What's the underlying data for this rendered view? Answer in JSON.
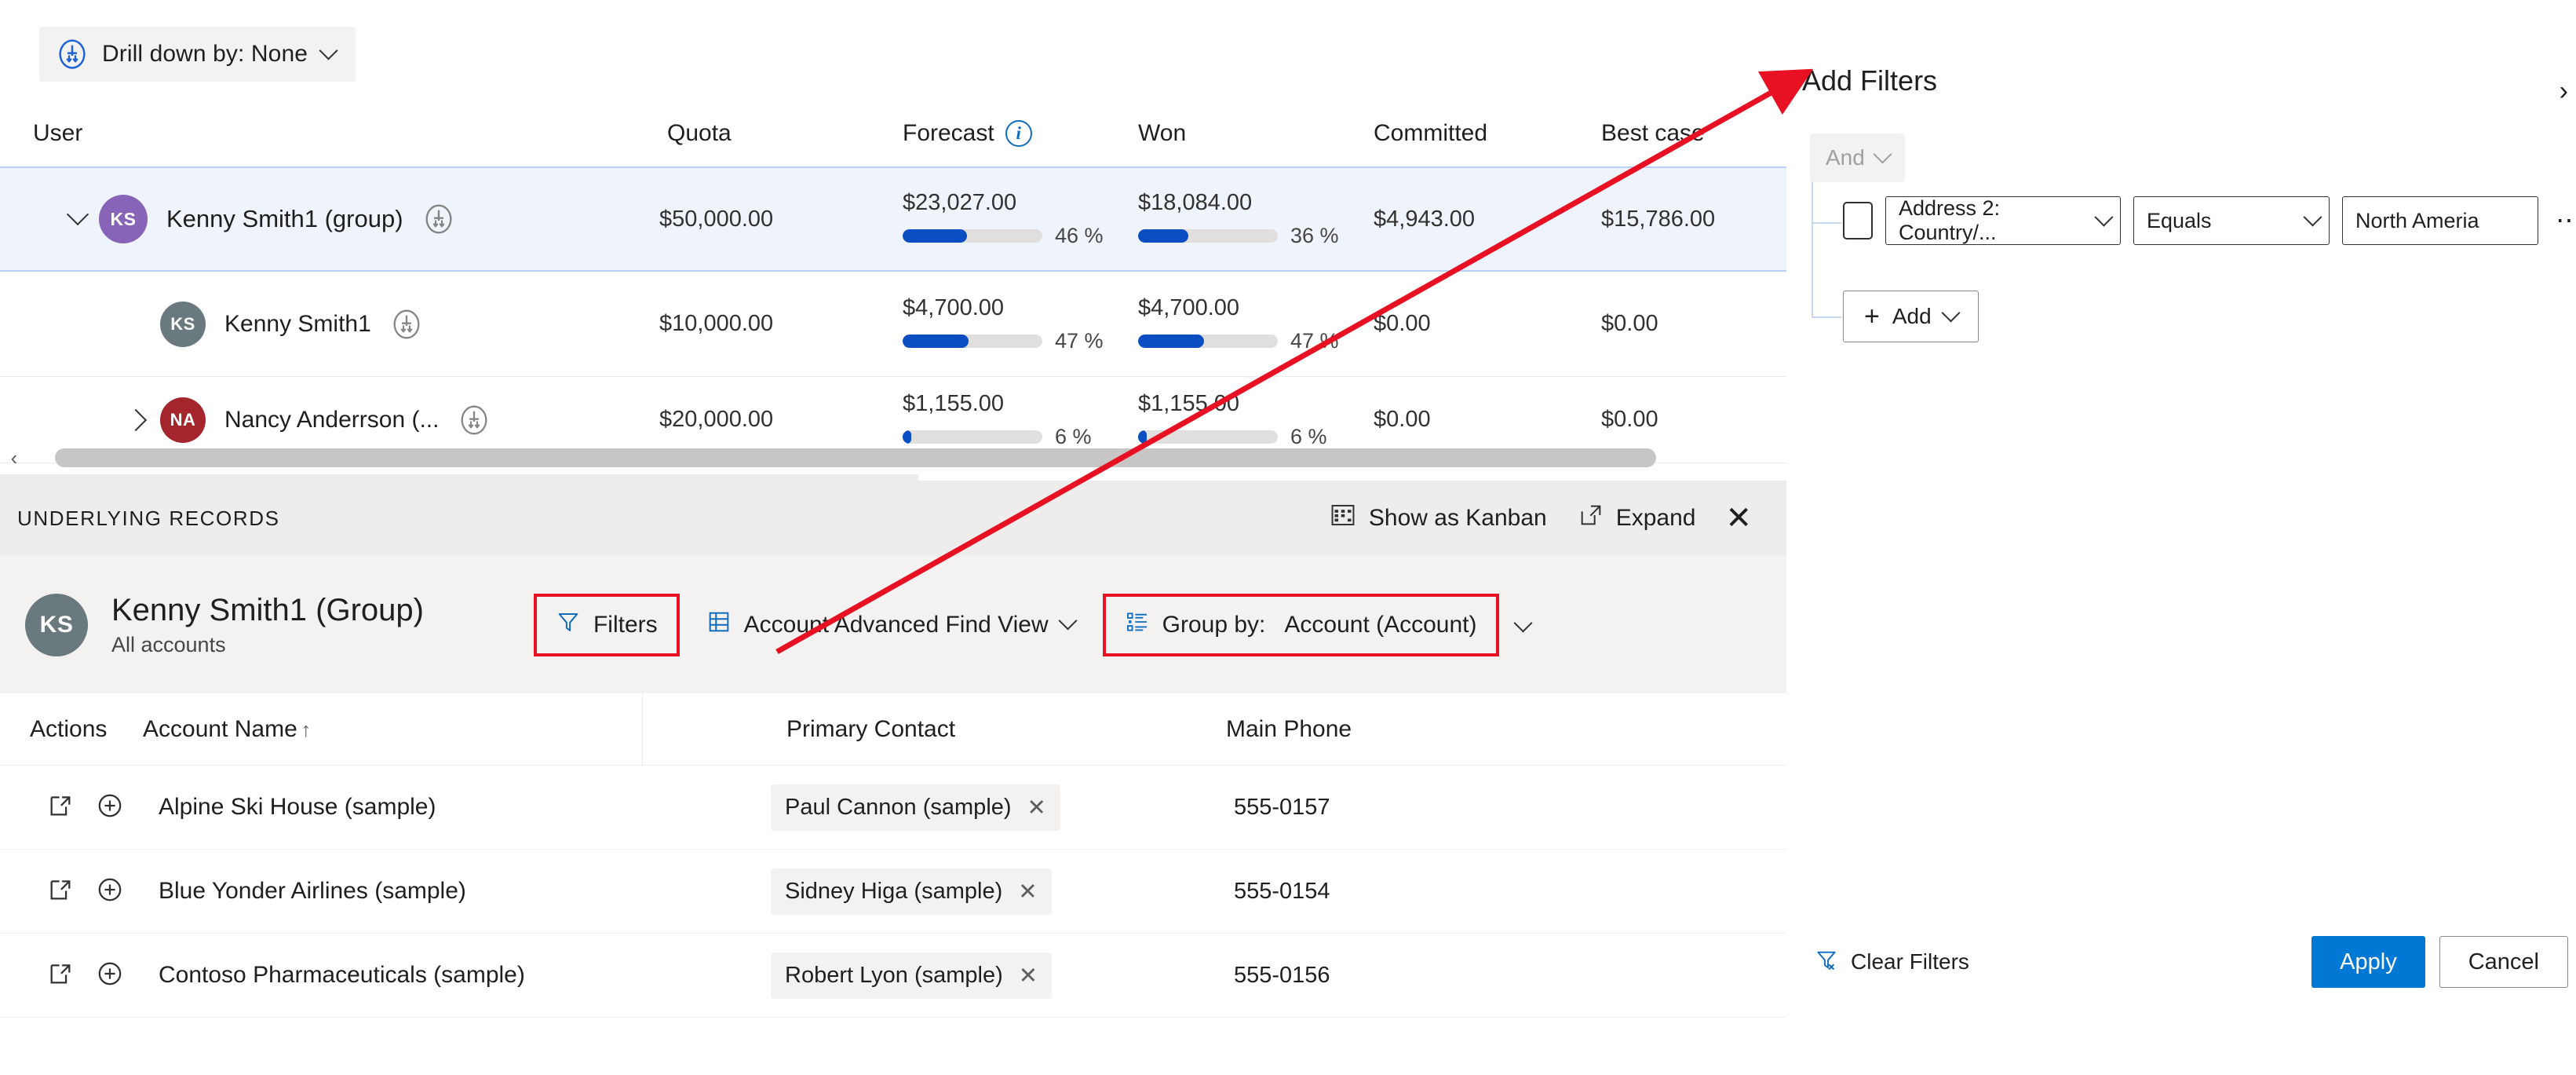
{
  "drilldown": {
    "label": "Drill down by: None",
    "icon": "drill-down-icon"
  },
  "forecast_grid": {
    "columns": [
      "User",
      "Quota",
      "Forecast",
      "Won",
      "Committed",
      "Best case"
    ],
    "forecast_info_tooltip": "i",
    "rows": [
      {
        "user": "Kenny Smith1 (group)",
        "initials": "KS",
        "avatar_color": "#8764b8",
        "quota": "$50,000.00",
        "forecast_value": "$23,027.00",
        "forecast_pct": "46 %",
        "forecast_pct_num": 46,
        "won_value": "$18,084.00",
        "won_pct": "36 %",
        "won_pct_num": 36,
        "committed": "$4,943.00",
        "best_case": "$15,786.00",
        "expanded": true,
        "selected": true
      },
      {
        "user": "Kenny Smith1",
        "initials": "KS",
        "avatar_color": "#69797e",
        "quota": "$10,000.00",
        "forecast_value": "$4,700.00",
        "forecast_pct": "47 %",
        "forecast_pct_num": 47,
        "won_value": "$4,700.00",
        "won_pct": "47 %",
        "won_pct_num": 47,
        "committed": "$0.00",
        "best_case": "$0.00",
        "expanded": null,
        "selected": false
      },
      {
        "user": "Nancy Anderrson (...",
        "initials": "NA",
        "avatar_color": "#a4262c",
        "quota": "$20,000.00",
        "forecast_value": "$1,155.00",
        "forecast_pct": "6 %",
        "forecast_pct_num": 6,
        "won_value": "$1,155.00",
        "won_pct": "6 %",
        "won_pct_num": 6,
        "committed": "$0.00",
        "best_case": "$0.00",
        "expanded": false,
        "selected": false
      }
    ]
  },
  "underlying_records": {
    "title": "UNDERLYING RECORDS",
    "show_as_kanban": "Show as Kanban",
    "expand": "Expand",
    "close": "✕",
    "owner": {
      "initials": "KS",
      "avatar_color": "#69797e",
      "name": "Kenny Smith1 (Group)",
      "subtitle": "All accounts"
    },
    "toolbar": {
      "filters": "Filters",
      "view": "Account Advanced Find View",
      "group_by_label": "Group by:",
      "group_by_value": "Account (Account)"
    },
    "table": {
      "columns": [
        "Actions",
        "Account Name",
        "Primary Contact",
        "Main Phone"
      ],
      "sort_indicator": "↑",
      "rows": [
        {
          "account": "Alpine Ski House (sample)",
          "contact": "Paul Cannon (sample)",
          "phone": "555-0157"
        },
        {
          "account": "Blue Yonder Airlines (sample)",
          "contact": "Sidney Higa (sample)",
          "phone": "555-0154"
        },
        {
          "account": "Contoso Pharmaceuticals (sample)",
          "contact": "Robert Lyon (sample)",
          "phone": "555-0156"
        }
      ]
    }
  },
  "filter_panel": {
    "title": "Add Filters",
    "close": "✕",
    "collapse": "›",
    "logic_operator": "And",
    "row": {
      "field": "Address 2: Country/...",
      "operator": "Equals",
      "value": "North Ameria",
      "more": "⋯"
    },
    "add_button": "Add",
    "clear_filters": "Clear Filters",
    "apply": "Apply",
    "cancel": "Cancel"
  },
  "colors": {
    "accent_blue": "#0078d4",
    "bar_blue": "#0b4ec2",
    "annotation_red": "#e81123",
    "selected_row": "#eff3fc",
    "panel_grey": "#f3f2f1"
  }
}
